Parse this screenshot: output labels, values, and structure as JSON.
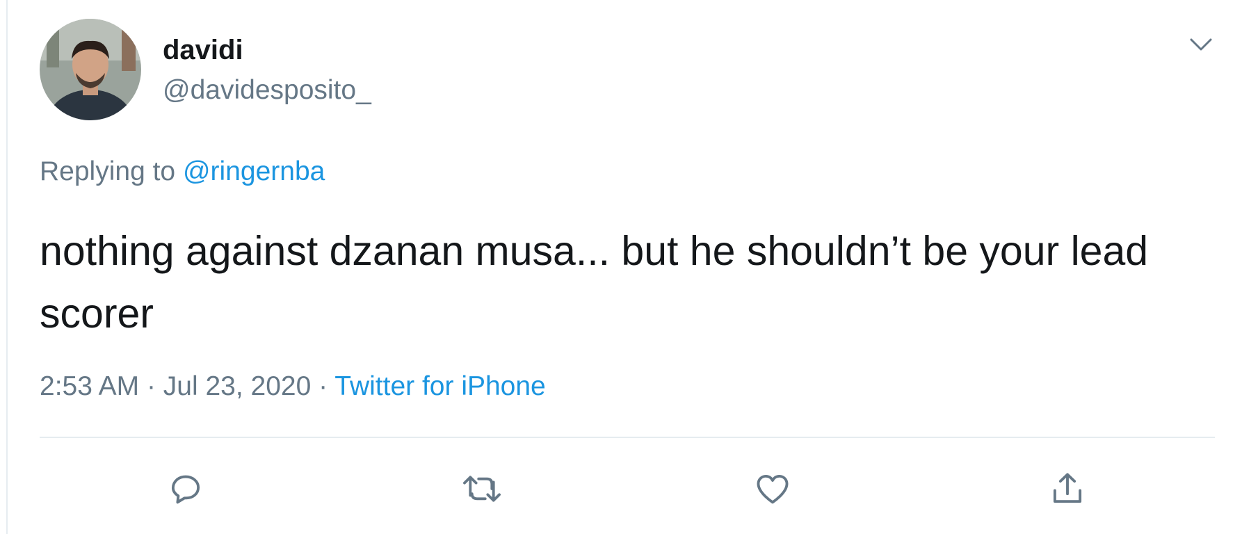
{
  "user": {
    "display_name": "davidi",
    "handle": "@davidesposito_"
  },
  "reply": {
    "prefix": "Replying to",
    "mention": "@ringernba"
  },
  "tweet": {
    "text": "nothing against dzanan musa... but he shouldn’t be your lead scorer"
  },
  "meta": {
    "time": "2:53 AM",
    "sep1": "·",
    "date": "Jul 23, 2020",
    "sep2": "·",
    "source": "Twitter for iPhone"
  },
  "actions": [
    {
      "icon": "reply-icon"
    },
    {
      "icon": "retweet-icon"
    },
    {
      "icon": "like-icon"
    },
    {
      "icon": "share-icon"
    }
  ],
  "colors": {
    "primary_text": "#14171a",
    "secondary_text": "#657786",
    "link": "#1b95e0",
    "divider": "#e6ecf0"
  }
}
